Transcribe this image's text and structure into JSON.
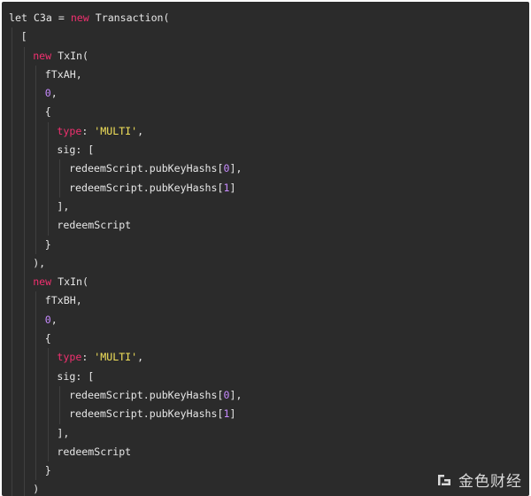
{
  "code": {
    "lines": [
      {
        "indent": 0,
        "tokens": [
          {
            "t": "plain",
            "v": "let C3a = "
          },
          {
            "t": "kw",
            "v": "new"
          },
          {
            "t": "plain",
            "v": " Transaction("
          }
        ]
      },
      {
        "indent": 1,
        "tokens": [
          {
            "t": "plain",
            "v": "["
          }
        ]
      },
      {
        "indent": 2,
        "tokens": [
          {
            "t": "kw",
            "v": "new"
          },
          {
            "t": "plain",
            "v": " TxIn("
          }
        ]
      },
      {
        "indent": 3,
        "tokens": [
          {
            "t": "plain",
            "v": "fTxAH,"
          }
        ]
      },
      {
        "indent": 3,
        "tokens": [
          {
            "t": "num",
            "v": "0"
          },
          {
            "t": "plain",
            "v": ","
          }
        ]
      },
      {
        "indent": 3,
        "tokens": [
          {
            "t": "plain",
            "v": "{"
          }
        ]
      },
      {
        "indent": 4,
        "tokens": [
          {
            "t": "prop",
            "v": "type"
          },
          {
            "t": "plain",
            "v": ": "
          },
          {
            "t": "str",
            "v": "'MULTI'"
          },
          {
            "t": "plain",
            "v": ","
          }
        ]
      },
      {
        "indent": 4,
        "tokens": [
          {
            "t": "plain",
            "v": "sig: ["
          }
        ]
      },
      {
        "indent": 5,
        "tokens": [
          {
            "t": "plain",
            "v": "redeemScript.pubKeyHashs["
          },
          {
            "t": "num",
            "v": "0"
          },
          {
            "t": "plain",
            "v": "],"
          }
        ]
      },
      {
        "indent": 5,
        "tokens": [
          {
            "t": "plain",
            "v": "redeemScript.pubKeyHashs["
          },
          {
            "t": "num",
            "v": "1"
          },
          {
            "t": "plain",
            "v": "]"
          }
        ]
      },
      {
        "indent": 4,
        "tokens": [
          {
            "t": "plain",
            "v": "],"
          }
        ]
      },
      {
        "indent": 4,
        "tokens": [
          {
            "t": "plain",
            "v": "redeemScript"
          }
        ]
      },
      {
        "indent": 3,
        "tokens": [
          {
            "t": "plain",
            "v": "}"
          }
        ]
      },
      {
        "indent": 2,
        "tokens": [
          {
            "t": "plain",
            "v": "),"
          }
        ]
      },
      {
        "indent": 2,
        "tokens": [
          {
            "t": "kw",
            "v": "new"
          },
          {
            "t": "plain",
            "v": " TxIn("
          }
        ]
      },
      {
        "indent": 3,
        "tokens": [
          {
            "t": "plain",
            "v": "fTxBH,"
          }
        ]
      },
      {
        "indent": 3,
        "tokens": [
          {
            "t": "num",
            "v": "0"
          },
          {
            "t": "plain",
            "v": ","
          }
        ]
      },
      {
        "indent": 3,
        "tokens": [
          {
            "t": "plain",
            "v": "{"
          }
        ]
      },
      {
        "indent": 4,
        "tokens": [
          {
            "t": "prop",
            "v": "type"
          },
          {
            "t": "plain",
            "v": ": "
          },
          {
            "t": "str",
            "v": "'MULTI'"
          },
          {
            "t": "plain",
            "v": ","
          }
        ]
      },
      {
        "indent": 4,
        "tokens": [
          {
            "t": "plain",
            "v": "sig: ["
          }
        ]
      },
      {
        "indent": 5,
        "tokens": [
          {
            "t": "plain",
            "v": "redeemScript.pubKeyHashs["
          },
          {
            "t": "num",
            "v": "0"
          },
          {
            "t": "plain",
            "v": "],"
          }
        ]
      },
      {
        "indent": 5,
        "tokens": [
          {
            "t": "plain",
            "v": "redeemScript.pubKeyHashs["
          },
          {
            "t": "num",
            "v": "1"
          },
          {
            "t": "plain",
            "v": "]"
          }
        ]
      },
      {
        "indent": 4,
        "tokens": [
          {
            "t": "plain",
            "v": "],"
          }
        ]
      },
      {
        "indent": 4,
        "tokens": [
          {
            "t": "plain",
            "v": "redeemScript"
          }
        ]
      },
      {
        "indent": 3,
        "tokens": [
          {
            "t": "plain",
            "v": "}"
          }
        ]
      },
      {
        "indent": 2,
        "tokens": [
          {
            "t": "plain",
            "v": ")"
          }
        ]
      }
    ]
  },
  "watermark": {
    "text": "金色财经",
    "icon": "golden-logo-icon"
  },
  "colors": {
    "background": "#2b2b2b",
    "plain": "#e6e6e6",
    "keyword": "#f0306f",
    "number": "#c78bff",
    "string": "#f1e05a"
  }
}
